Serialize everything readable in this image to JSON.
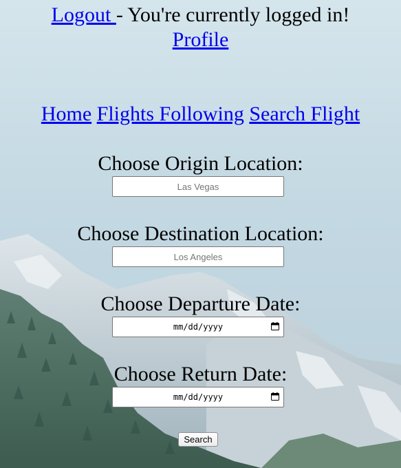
{
  "header": {
    "logout_label": "Logout ",
    "status_text": " - You're currently logged in!",
    "profile_label": "Profile"
  },
  "nav": {
    "items": [
      {
        "label": "Home"
      },
      {
        "label": "Flights Following"
      },
      {
        "label": "Search Flight"
      }
    ]
  },
  "form": {
    "origin": {
      "label": "Choose Origin Location:",
      "placeholder": "Las Vegas",
      "value": ""
    },
    "destination": {
      "label": "Choose Destination Location:",
      "placeholder": "Los Angeles",
      "value": ""
    },
    "departure": {
      "label": "Choose Departure Date:",
      "placeholder": "mm/dd/yyyy"
    },
    "return": {
      "label": "Choose Return Date:",
      "placeholder": "mm/dd/yyyy"
    },
    "search_label": "Search"
  },
  "colors": {
    "link": "#0000ee",
    "sky": "#c9dbe3"
  },
  "icons": {
    "date_picker": "calendar-icon"
  }
}
